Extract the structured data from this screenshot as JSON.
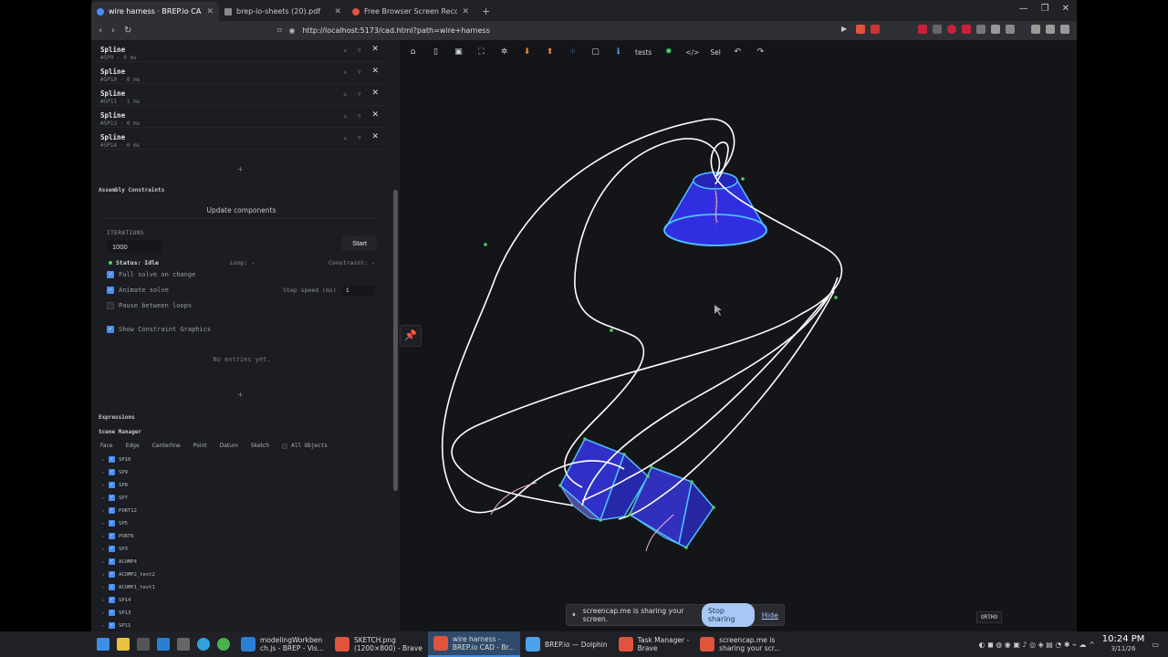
{
  "browser": {
    "tabs": [
      {
        "title": "wire harness · BREP.io CAD",
        "active": true,
        "fav": "brep"
      },
      {
        "title": "brep-io-sheets (20).pdf",
        "active": false,
        "fav": "pdf"
      },
      {
        "title": "Free Browser Screen Record",
        "active": false,
        "fav": "rec"
      }
    ],
    "new_tab": "+",
    "url": "http://localhost:5173/cad.html?path=wire+harness"
  },
  "features": [
    {
      "name": "Spline",
      "sub": "#SP9 · 0 ms"
    },
    {
      "name": "Spline",
      "sub": "#SP10 · 0 ms"
    },
    {
      "name": "Spline",
      "sub": "#SP11 · 1 ms"
    },
    {
      "name": "Spline",
      "sub": "#SP13 · 0 ms"
    },
    {
      "name": "Spline",
      "sub": "#SP14 · 0 ms"
    }
  ],
  "feature_controls": {
    "up": "▵",
    "down": "▿",
    "remove": "✕"
  },
  "add": "+",
  "assembly": {
    "title": "Assembly Constraints",
    "update_label": "Update components",
    "iterations_label": "ITERATIONS",
    "iterations_value": "1000",
    "start_label": "Start",
    "status": "Status: Idle",
    "loop": "Loop: -",
    "constraint": "Constraint: -",
    "full_solve": "Full solve on change",
    "animate": "Animate solve",
    "step_label": "Step speed (ms)",
    "step_value": "1",
    "pause": "Pause between loops",
    "show_graphics": "Show Constraint Graphics",
    "no_entries": "No entries yet."
  },
  "expressions_title": "Expressions",
  "scene": {
    "title": "Scene Manager",
    "filters": [
      "Face",
      "Edge",
      "Centerline",
      "Point",
      "Datum",
      "Sketch"
    ],
    "all_objects": "All Objects",
    "items": [
      "SP10",
      "SP9",
      "SP8",
      "SP7",
      "PORT12",
      "SP5",
      "PORT6",
      "SP3",
      "ACOMP4",
      "ACOMP2_test2",
      "ACOMP1_test1",
      "SP14",
      "SP13",
      "SP11"
    ]
  },
  "toolbar": {
    "tests": "tests",
    "code": "</>",
    "sel": "Sel",
    "undo": "↶",
    "redo": "↷"
  },
  "ortho": "ORTHO",
  "share": {
    "pause": "⏸",
    "message": "screencap.me is sharing your screen.",
    "stop": "Stop sharing",
    "hide": "Hide"
  },
  "taskbar": {
    "tasks": [
      {
        "line1": "modelingWorkben",
        "line2": "ch.js - BREP - Vis...",
        "color": "#2a7fd4"
      },
      {
        "line1": "SKETCH.png",
        "line2": "(1200×800) - Brave",
        "color": "#e0533c"
      },
      {
        "line1": "wire harness -",
        "line2": "BREP.io CAD - Br...",
        "color": "#e0533c",
        "active": true
      },
      {
        "line1": "BREP.io — Dolphin",
        "line2": "",
        "color": "#4aa3e8"
      },
      {
        "line1": "Task Manager -",
        "line2": "Brave",
        "color": "#e0533c"
      },
      {
        "line1": "screencap.me is",
        "line2": "sharing your scr...",
        "color": "#e0533c"
      }
    ],
    "time": "10:24 PM",
    "date": "3/11/26"
  },
  "colors": {
    "solid_blue": "#3030e0",
    "solid_edge": "#4fc0ff",
    "wire": "#ffffff",
    "accent": "#4c8df2"
  }
}
